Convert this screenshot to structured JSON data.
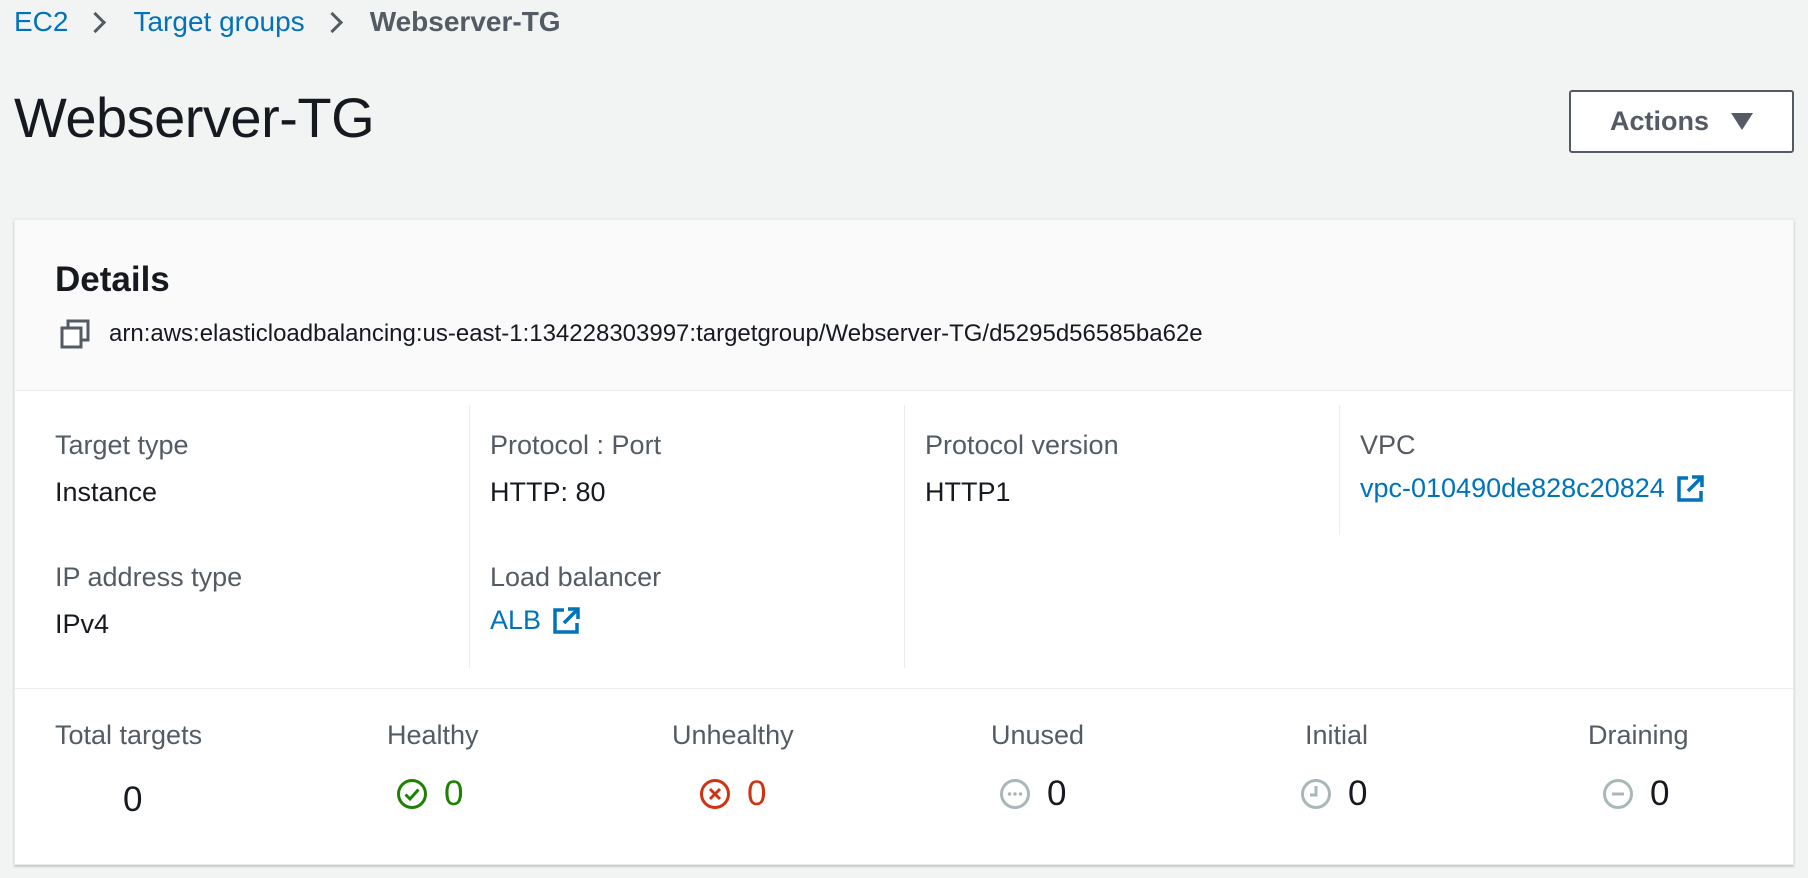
{
  "breadcrumb": {
    "items": [
      "EC2",
      "Target groups"
    ],
    "current": "Webserver-TG"
  },
  "header": {
    "title": "Webserver-TG",
    "actions_label": "Actions"
  },
  "details": {
    "title": "Details",
    "arn": "arn:aws:elasticloadbalancing:us-east-1:134228303997:targetgroup/Webserver-TG/d5295d56585ba62e",
    "fields": {
      "target_type": {
        "label": "Target type",
        "value": "Instance"
      },
      "ip_address_type": {
        "label": "IP address type",
        "value": "IPv4"
      },
      "protocol_port": {
        "label": "Protocol : Port",
        "value": "HTTP: 80"
      },
      "load_balancer": {
        "label": "Load balancer",
        "value": "ALB"
      },
      "protocol_version": {
        "label": "Protocol version",
        "value": "HTTP1"
      },
      "vpc": {
        "label": "VPC",
        "value": "vpc-010490de828c20824"
      }
    },
    "stats": {
      "total": {
        "label": "Total targets",
        "value": "0"
      },
      "healthy": {
        "label": "Healthy",
        "value": "0",
        "icon": "check-circle-icon",
        "color": "#1d8102"
      },
      "unhealthy": {
        "label": "Unhealthy",
        "value": "0",
        "icon": "x-circle-icon",
        "color": "#d13212"
      },
      "unused": {
        "label": "Unused",
        "value": "0",
        "icon": "ellipsis-circle-icon",
        "color": "#16191f"
      },
      "initial": {
        "label": "Initial",
        "value": "0",
        "icon": "clock-icon",
        "color": "#16191f"
      },
      "draining": {
        "label": "Draining",
        "value": "0",
        "icon": "minus-circle-icon",
        "color": "#16191f"
      }
    }
  },
  "colors": {
    "link": "#0073bb",
    "muted": "#545b64",
    "icon_gray": "#aab7b8",
    "success": "#1d8102",
    "error": "#d13212"
  }
}
